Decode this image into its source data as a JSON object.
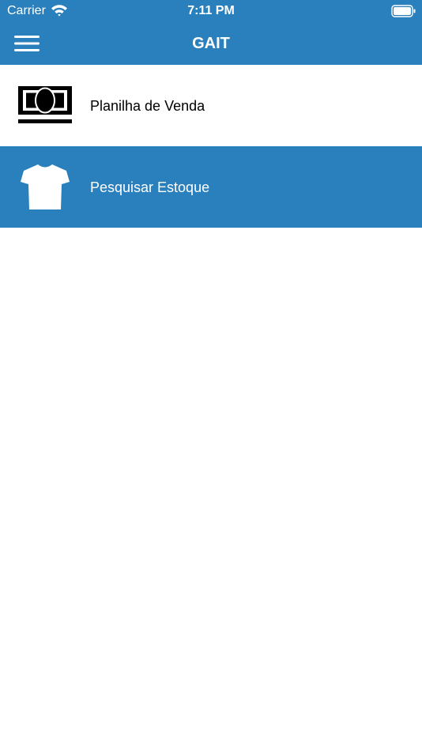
{
  "status_bar": {
    "carrier": "Carrier",
    "time": "7:11 PM"
  },
  "nav": {
    "title": "GAIT",
    "menu_icon": "hamburger-menu-icon"
  },
  "menu": {
    "items": [
      {
        "label": "Planilha de Venda",
        "icon": "money-bill-icon",
        "selected": false
      },
      {
        "label": "Pesquisar Estoque",
        "icon": "tshirt-icon",
        "selected": true
      }
    ]
  },
  "colors": {
    "primary": "#2a7fbd",
    "background": "#ffffff",
    "text": "#000000"
  }
}
